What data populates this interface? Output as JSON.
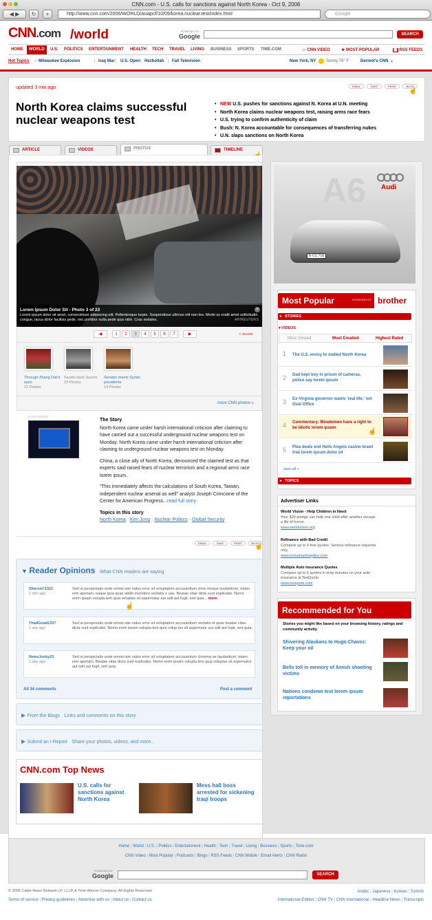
{
  "browser": {
    "title": "CNN.com - U.S. calls for sanctions against North Korea - Oct 9, 2006",
    "url": "http://www.cnn.com/2006/WORLD/asiapcf/10/09/korea.nuclear.test/index.html",
    "search_placeholder": "Google"
  },
  "header": {
    "logo_cnn": "CNN",
    "logo_com": ".com",
    "section": "/world",
    "powered_by": "POWERED BY",
    "google": "Google",
    "search_btn": "SEARCH"
  },
  "nav": {
    "items": [
      "HOME",
      "WORLD",
      "U.S.",
      "POLITICS",
      "ENTERTAINMENT",
      "HEALTH",
      "TECH",
      "TRAVEL",
      "LIVING",
      "BUSINESS",
      "SPORTS",
      "TIME.COM"
    ],
    "cnn_video": "CNN VIDEO",
    "most_popular": "MOST POPULAR",
    "rss": "RSS FEEDS"
  },
  "hotbar": {
    "label": "Hot Topics",
    "topics": [
      "Milwaukee Explosion",
      "Iraq War",
      "U.S. Open",
      "Hezbollah",
      "Fall Television"
    ],
    "location": "New York, NY",
    "weather": "Sunny 79° F",
    "user": "Dermot's CNN"
  },
  "article": {
    "updated": "updated 3 min ago",
    "tools": [
      "EMAIL",
      "SAVE",
      "PRINT",
      "BLOG"
    ],
    "headline": "North Korea claims successful nuclear weapons test",
    "new_label": "NEW",
    "bullets": [
      "U.S. pushes for sanctions against N. Korea at U.N. meeting",
      "North Korea claims nuclear weapons test, raising arms race fears",
      "U.S. trying to confirm authenticity of claim",
      "Bush: N. Korea accountable for consequences of transferring nukes",
      "U.N. slaps sanctions on North Korea"
    ],
    "tabs": [
      "ARTICLE",
      "VIDEOS",
      "PHOTOS",
      "TIMELINE"
    ]
  },
  "gallery": {
    "caption_title": "Lorem Ipsum Dolor Sit - Photo 3 of 23",
    "caption_text": "Lorem ipsum dolor sit amet, consectetuer adipiscing elit. Pellentesque turpis. Suspendisse ultrices elit non leo. Morbi so eratit amet sollicitudin congue, lacus dolor facilisis pede, nec porttitor nulla pede quis nibh. Cras sodales.",
    "credit": "AP/REUTERS",
    "pages": [
      "1",
      "2",
      "3",
      "4",
      "5",
      "6",
      "7"
    ],
    "share": "SHARE",
    "thumbs": [
      {
        "title": "Through Zhang Dali's eyes",
        "count": "12 Photos"
      },
      {
        "title": "Saudis back Sunnis",
        "count": "23 Photos"
      },
      {
        "title": "Senator meets Syrian presidents",
        "count": "14 Photos"
      }
    ],
    "more": "more CNN photos »"
  },
  "story": {
    "ad_label": "ADVERTISEMENT",
    "title": "The Story",
    "p1": "North Korea came under harsh international criticism after claiming to have carried out a successful underground nuclear weapons test on Monday. North Korea came under harsh international criticism after claiming to underground nuclear weapons test on Monday.",
    "p2": "China, a close ally of North Korea, denounced the claimed test as that experts said raised fears of nuclear terrorism and a regional arms race lorem ipsum.",
    "p3": "\"This immediately affects the calculations of South Korea, Taiwan, independent nuclear arsenal as well\" analyst Joseph Cirincione of the Center for American Progress...",
    "read_full": "read full story",
    "topics_title": "Topics in this story",
    "topics": [
      "North Korea",
      "Kim Jong",
      "Nuclear Politics",
      "Global Security"
    ]
  },
  "opinions": {
    "title": "Reader Opinions",
    "subtitle": "What CNN readers are saying",
    "items": [
      {
        "user": "SharonC1321",
        "time": "2 min ago",
        "text": "Sed ut perspiciatis unde omnis iste natus error sit voluptatem accusantium clore moque laudantium, totam rem aperiam, eaque ipsa quae abillo inventore veritatis e uas. Beatae vitae dicta sunt explicabo. Nemo enim ipsam volupta tem quia voluptas sit aspernatur aut odit aut fugit, sed quia...",
        "more": "more"
      },
      {
        "user": "ThadGoad1337",
        "time": "1 day ago",
        "text": "Sed ut perspiciatis unde omnis iste natus error sit voluptatem accusantium veritatis et quas beatae vitae dicta sunt explicabo. Nemo enim ipsam volupta tem quia volup tax sit aspernatur aut odit aut fugit, sed quia."
      },
      {
        "user": "NewsJunky23",
        "time": "1 day ago",
        "text": "Sed ut perspiciatis unde omnis iste natus error sit voluptatem accusantium cloremq ue laudantium, totam rem aperiam. Beatae vitae dicta sunt explicabo. Nemo enim ipsam volupta tem quia voluptas sit aspernatur aut odit aut fugit, sed quia."
      }
    ],
    "all": "All 34 comments",
    "post": "Post a comment"
  },
  "blogs": {
    "title": "From the Blogs",
    "subtitle": "Links and comments on this story"
  },
  "ireport": {
    "title": "Submit an i-Report",
    "subtitle": "Share your photos, videos, and more..."
  },
  "topnews": {
    "title": "CNN.com Top News",
    "items": [
      "U.S. calls for sanctions against North Korea",
      "Mess hall boss arrested for sickening Iraqi troops"
    ]
  },
  "ad": {
    "model": "A6",
    "brand": "Audi",
    "plate": "B·CC 718"
  },
  "most_popular": {
    "title": "Most Popular",
    "sponsored": "SPONSORED BY",
    "sponsor": "brother",
    "stories": "STORIES",
    "videos": "VIDEOS",
    "tabs": [
      "Most Viewed",
      "Most Emailed",
      "Highest Rated"
    ],
    "items": [
      {
        "n": "1",
        "text": "The U.S. envoy to stalled North Korea"
      },
      {
        "n": "2",
        "text": "Dad kept boy in prison of cameras, police say lorem ipsum"
      },
      {
        "n": "3",
        "text": "Ex-Virginia governor wants 'real life,' not Oval Office"
      },
      {
        "n": "4",
        "text": "Commentary: Minutemen have a right to be idiotic lorem ipsum"
      },
      {
        "n": "5",
        "text": "Plea deals end Hells Angels casino brawl trial lorem ipsum dolor sit"
      }
    ],
    "view_all": "view all »",
    "topics": "TOPICS"
  },
  "advertiser": {
    "title": "Advertiser Links",
    "items": [
      {
        "title": "World Vision - Help Children in Need",
        "text": "Your $20 pledge can help one child after another escape a life of horror.",
        "url": "www.worldvision.org"
      },
      {
        "title": "Refinance with Bad Credit",
        "text": "Compare up to 4 free quotes. Serious refinance requests only.",
        "url": "www.homeloanhelpline.com"
      },
      {
        "title": "Multiple Auto Insurance Quotes",
        "text": "Compare up to 6 quotes in sixty minutes on your auto insurance at NetQuote.",
        "url": "www.netquote.com"
      }
    ]
  },
  "recommended": {
    "title": "Recommended for You",
    "intro": "Stories you might like based on your browsing history, ratings and community activity.",
    "items": [
      "Shivering Alaskans to Hugo Chavez: Keep your oil",
      "Bells toll in memory of Amish shooting victims",
      "Nations condemn test lorem ipsum reportations"
    ]
  },
  "footer": {
    "links1": [
      "Home",
      "World",
      "U.S.",
      "Politics",
      "Entertainment",
      "Health",
      "Tech",
      "Travel",
      "Living",
      "Business",
      "Sports",
      "Time.com"
    ],
    "links2": [
      "CNN Video",
      "Most Popular",
      "Podcasts",
      "Blogs",
      "RSS Feeds",
      "CNN Mobile",
      "Email Alerts",
      "CNN Radio"
    ],
    "powered_by": "POWERED BY",
    "google": "Google",
    "search_btn": "SEARCH",
    "copyright": "© 2006 Cable News Network LP, LLLP. A Time Warner Company. All Rights Reserved.",
    "legal": [
      "Terms of service",
      "Privacy guidelines",
      "Advertise with us",
      "About us",
      "Contact us"
    ],
    "languages": [
      "Arabic",
      "Japanese",
      "Korean",
      "Turkish"
    ],
    "editions": [
      "International Edition",
      "CNN TV",
      "CNN International",
      "Headline News",
      "Transcripts"
    ]
  }
}
